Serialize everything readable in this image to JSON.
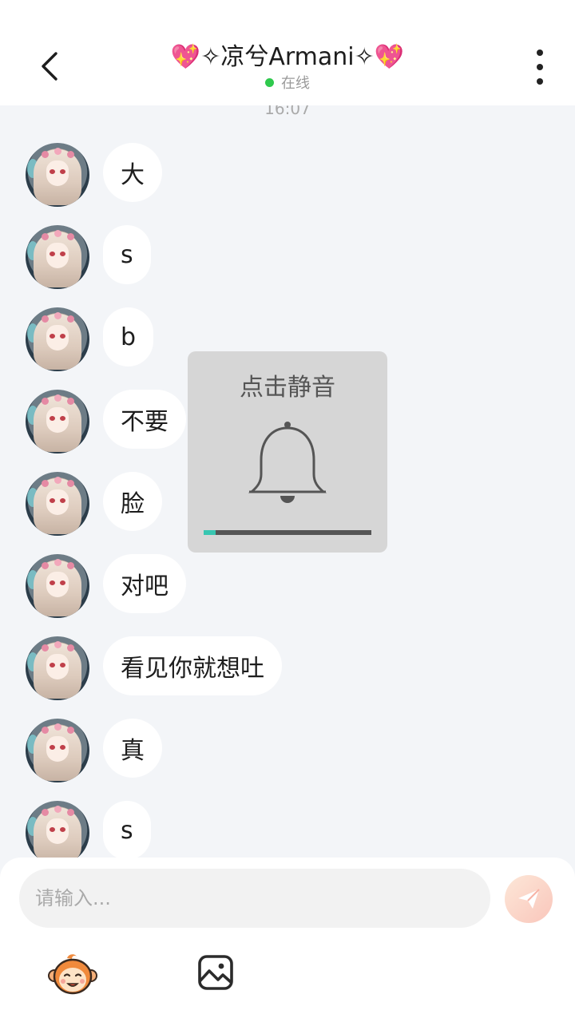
{
  "header": {
    "title": "💖✧凉兮Armani✧💖",
    "status_text": "在线",
    "back_icon": "chevron-left-icon",
    "more_icon": "more-vertical-icon",
    "status_color": "#2fc94d"
  },
  "timestamp": "16:07",
  "messages": [
    {
      "text": "大"
    },
    {
      "text": "s"
    },
    {
      "text": "b"
    },
    {
      "text": "不要"
    },
    {
      "text": "脸"
    },
    {
      "text": "对吧"
    },
    {
      "text": "看见你就想吐"
    },
    {
      "text": "真"
    },
    {
      "text": "s"
    }
  ],
  "mute_popup": {
    "label": "点击静音",
    "icon": "bell-icon",
    "progress": 0.07,
    "progress_color": "#38c6b1"
  },
  "composer": {
    "placeholder": "请输入...",
    "send_icon": "send-icon",
    "emoji_icon": "monkey-emoji-icon",
    "image_icon": "image-icon"
  }
}
